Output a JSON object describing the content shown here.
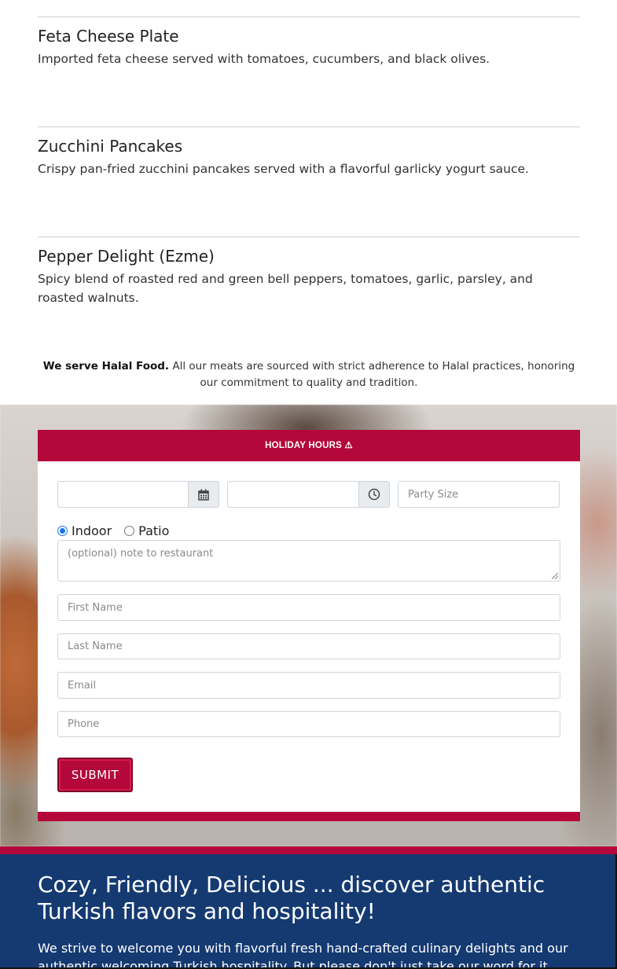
{
  "menu_items": [
    {
      "name": "Feta Cheese Plate",
      "description": "Imported feta cheese served with tomatoes, cucumbers, and black olives."
    },
    {
      "name": "Zucchini Pancakes",
      "description": "Crispy pan-fried zucchini pancakes served with a flavorful garlicky yogurt sauce."
    },
    {
      "name": "Pepper Delight (Ezme)",
      "description": "Spicy blend of roasted red and green bell peppers, tomatoes, garlic, parsley, and roasted walnuts."
    }
  ],
  "halal_notice": {
    "bold": "We serve Halal Food.",
    "text": " All our meats are sourced with strict adherence to Halal practices, honoring our commitment to quality and tradition."
  },
  "reservation": {
    "header": "HOLIDAY HOURS ⚠",
    "date_placeholder": "",
    "time_placeholder": "",
    "party_size_placeholder": "Party Size",
    "seating_options": [
      {
        "label": "Indoor",
        "selected": true
      },
      {
        "label": "Patio",
        "selected": false
      }
    ],
    "note_placeholder": "(optional) note to restaurant",
    "first_name_placeholder": "First Name",
    "last_name_placeholder": "Last Name",
    "email_placeholder": "Email",
    "phone_placeholder": "Phone",
    "submit_label": "SUBMIT",
    "icons": {
      "date": "calendar-icon",
      "time": "clock-icon"
    }
  },
  "about": {
    "heading": "Cozy, Friendly, Delicious ... discover authentic Turkish flavors and hospitality!",
    "text": "We strive to welcome you with flavorful fresh hand-crafted culinary delights and our authentic welcoming Turkish hospitality. But please don't just take our word for it."
  },
  "colors": {
    "accent": "#b5083a",
    "footer_bg": "#153a72"
  }
}
